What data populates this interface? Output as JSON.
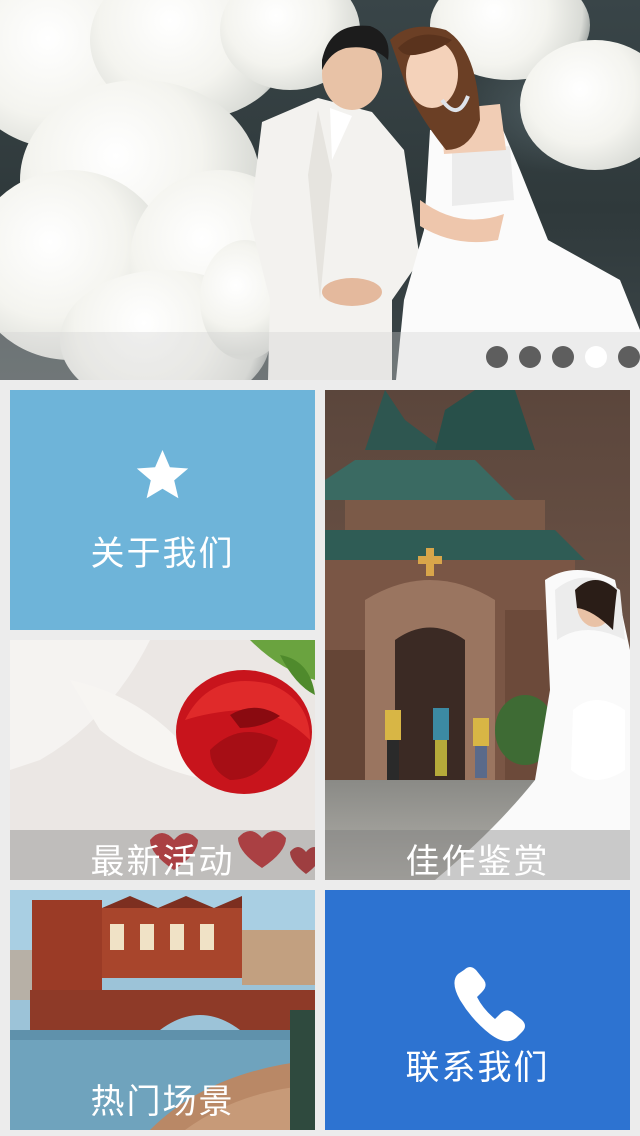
{
  "banner": {
    "slides": [
      {
        "active": false
      },
      {
        "active": false
      },
      {
        "active": false
      },
      {
        "active": true
      },
      {
        "active": false
      }
    ]
  },
  "tiles": {
    "about": {
      "label": "关于我们",
      "icon": "star-icon",
      "color": "#6eb4d9"
    },
    "works": {
      "label": "佳作鉴赏"
    },
    "news": {
      "label": "最新活动"
    },
    "scenes": {
      "label": "热门场景"
    },
    "contact": {
      "label": "联系我们",
      "icon": "phone-icon",
      "color": "#2d73d1"
    }
  }
}
